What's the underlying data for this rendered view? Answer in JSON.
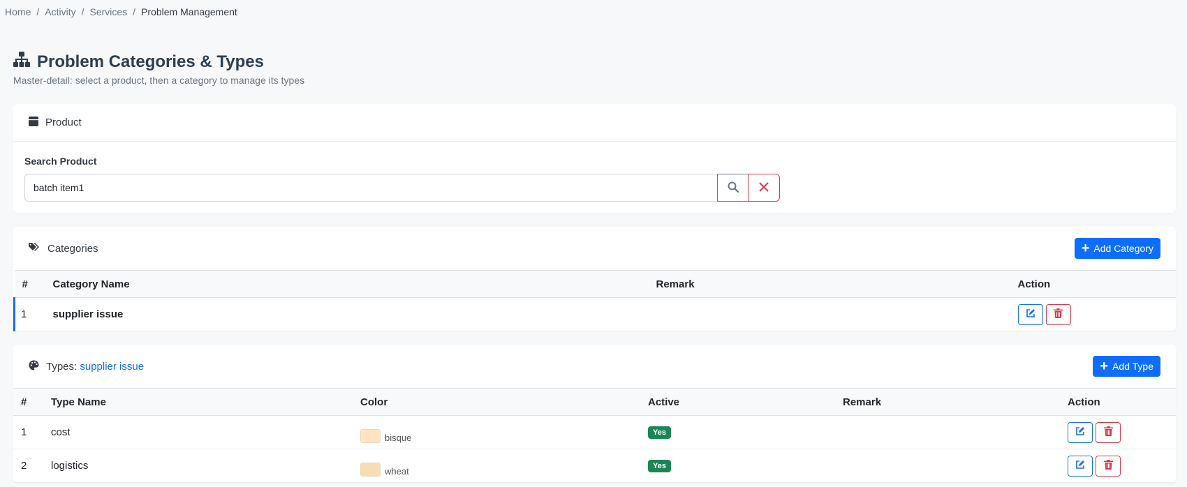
{
  "breadcrumb": {
    "items": [
      "Home",
      "Activity",
      "Services"
    ],
    "current": "Problem Management"
  },
  "header": {
    "title": "Problem Categories & Types",
    "subtitle": "Master-detail: select a product, then a category to manage its types"
  },
  "product": {
    "title": "Product",
    "search_label": "Search Product",
    "search_value": "batch item1"
  },
  "categories": {
    "title": "Categories",
    "add_label": "Add Category",
    "columns": [
      "#",
      "Category Name",
      "Remark",
      "Action"
    ],
    "rows": [
      {
        "no": "1",
        "name": "supplier issue",
        "remark": ""
      }
    ]
  },
  "types": {
    "title_prefix": "Types:",
    "selected_category": "supplier issue",
    "add_label": "Add Type",
    "columns": [
      "#",
      "Type Name",
      "Color",
      "Active",
      "Remark",
      "Action"
    ],
    "rows": [
      {
        "no": "1",
        "name": "cost",
        "color_name": "bisque",
        "color_hex": "#ffe4c4",
        "active": "Yes",
        "remark": ""
      },
      {
        "no": "2",
        "name": "logistics",
        "color_name": "wheat",
        "color_hex": "#f5deb3",
        "active": "Yes",
        "remark": ""
      }
    ]
  },
  "colors": {
    "primary": "#0d6efd",
    "danger": "#dc3545",
    "success": "#198754"
  }
}
